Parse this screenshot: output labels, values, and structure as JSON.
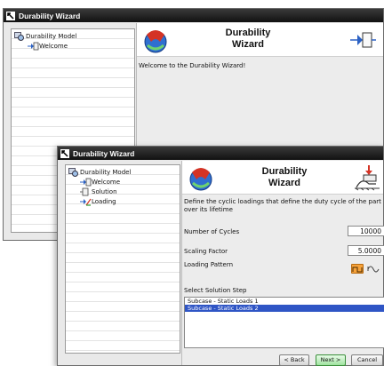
{
  "windows": [
    {
      "title": "Durability Wizard",
      "tree": {
        "root": "Durability Model",
        "items": [
          "Welcome"
        ]
      },
      "header": {
        "title_line1": "Durability",
        "title_line2": "Wizard"
      },
      "message": "Welcome to the Durability Wizard!"
    },
    {
      "title": "Durability Wizard",
      "tree": {
        "root": "Durability Model",
        "items": [
          "Welcome",
          "Solution",
          "Loading"
        ]
      },
      "header": {
        "title_line1": "Durability",
        "title_line2": "Wizard"
      },
      "description": "Define the cyclic loadings that define the duty cycle of the part over its lifetime",
      "fields": {
        "cycles_label": "Number of Cycles",
        "cycles_value": "10000",
        "scaling_label": "Scaling Factor",
        "scaling_value": "5.0000",
        "pattern_label": "Loading Pattern"
      },
      "solution_step": {
        "label": "Select Solution Step",
        "options": [
          "Subcase - Static Loads 1",
          "Subcase - Static Loads 2"
        ],
        "selected": "Subcase - Static Loads 2"
      },
      "buttons": {
        "back": "< Back",
        "next": "Next >",
        "cancel": "Cancel"
      }
    }
  ],
  "colors": {
    "titlebar": "#1c1c1c",
    "selection": "#2f55c5",
    "next_button": "#9fe39f"
  }
}
